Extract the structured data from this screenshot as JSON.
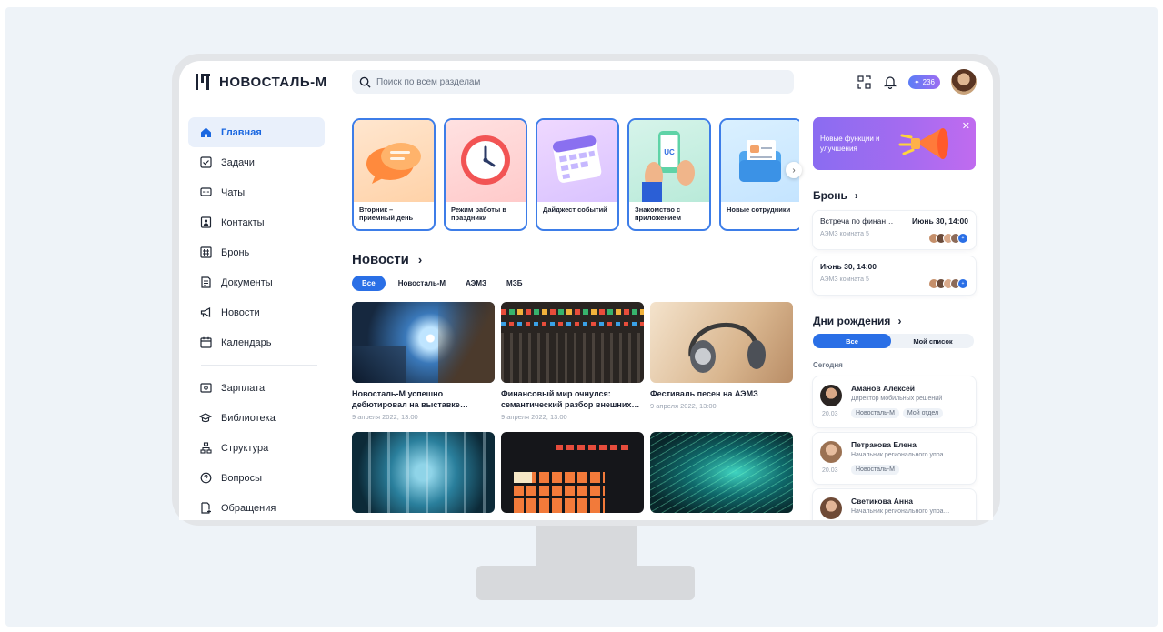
{
  "header": {
    "logo_text": "НОВОСТАЛЬ-М",
    "search_placeholder": "Поиск по всем разделам",
    "points": "236"
  },
  "sidebar": {
    "items": [
      {
        "label": "Главная",
        "icon": "home-icon"
      },
      {
        "label": "Задачи",
        "icon": "checkbox-icon"
      },
      {
        "label": "Чаты",
        "icon": "chat-icon"
      },
      {
        "label": "Контакты",
        "icon": "contacts-icon"
      },
      {
        "label": "Бронь",
        "icon": "booking-icon"
      },
      {
        "label": "Документы",
        "icon": "document-icon"
      },
      {
        "label": "Новости",
        "icon": "megaphone-icon"
      },
      {
        "label": "Календарь",
        "icon": "calendar-icon"
      }
    ],
    "items2": [
      {
        "label": "Зарплата",
        "icon": "salary-icon"
      },
      {
        "label": "Библиотека",
        "icon": "library-icon"
      },
      {
        "label": "Структура",
        "icon": "structure-icon"
      },
      {
        "label": "Вопросы",
        "icon": "question-icon"
      },
      {
        "label": "Обращения",
        "icon": "request-icon"
      }
    ]
  },
  "stories": [
    {
      "caption": "Вторник – приёмный день"
    },
    {
      "caption": "Режим работы в праздники"
    },
    {
      "caption": "Дайджест событий"
    },
    {
      "caption": "Знакомство с приложением"
    },
    {
      "caption": "Новые сотрудники"
    }
  ],
  "news": {
    "title": "Новости",
    "chips": [
      "Все",
      "Новосталь-М",
      "АЭМЗ",
      "МЗБ"
    ],
    "cards": [
      {
        "title": "Новосталь-М успешно дебютировал на выставке…",
        "date": "9 апреля 2022, 13:00"
      },
      {
        "title": "Финансовый мир очнулся: семантический разбор внешних…",
        "date": "9 апреля 2022, 13:00"
      },
      {
        "title": "Фестиваль песен на АЭМЗ",
        "date": "9 апреля 2022, 13:00"
      }
    ]
  },
  "promo": {
    "text": "Новые функции и улучшения"
  },
  "bron": {
    "title": "Бронь",
    "cards": [
      {
        "title": "Встреча по финан…",
        "time": "Июнь 30, 14:00",
        "room": "АЭМЗ комната 5"
      },
      {
        "title": "Июнь 30, 14:00",
        "time": "",
        "room": "АЭМЗ комната 5"
      }
    ]
  },
  "birthdays": {
    "title": "Дни рождения",
    "seg_all": "Все",
    "seg_mine": "Мой список",
    "today": "Сегодня",
    "people": [
      {
        "name": "Аманов Алексей",
        "role": "Директор мобильных решений",
        "date": "20.03",
        "tags": [
          "Новосталь-М",
          "Мой отдел"
        ]
      },
      {
        "name": "Петракова Елена",
        "role": "Начальник регионального упра…",
        "date": "20.03",
        "tags": [
          "Новосталь-М"
        ]
      },
      {
        "name": "Светикова Анна",
        "role": "Начальник регионального упра…",
        "date": "",
        "tags": []
      }
    ]
  },
  "colors": {
    "accent": "#2a6fe6",
    "background": "#eef3f8",
    "monitor": "#e3e5e8"
  }
}
